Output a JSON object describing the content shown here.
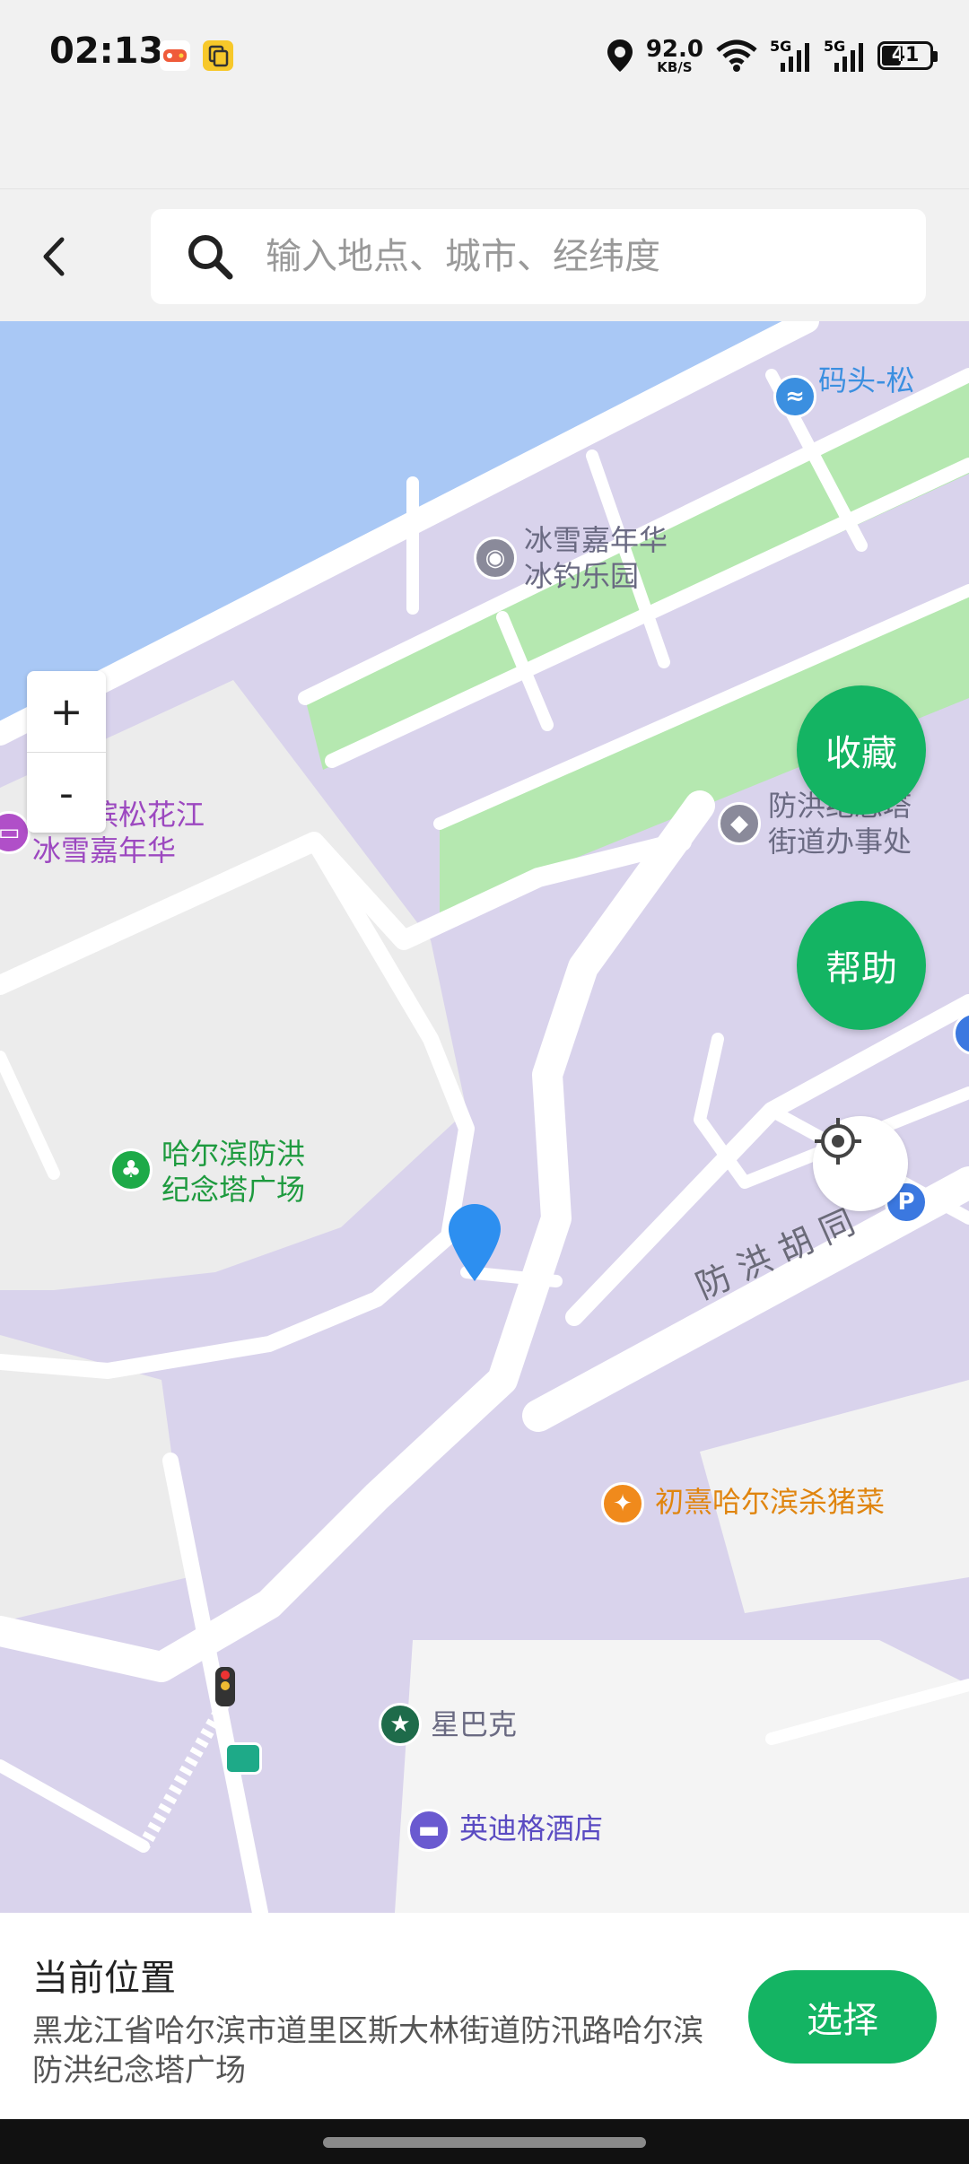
{
  "status_bar": {
    "time": "02:13",
    "net_speed": "92.0",
    "net_unit": "KB/S",
    "signal1": "5G",
    "signal2": "5G",
    "battery": "41"
  },
  "header": {
    "back_icon": "chevron-left-icon",
    "search_placeholder": "输入地点、城市、经纬度"
  },
  "map": {
    "zoom_in": "+",
    "zoom_out": "-",
    "favorite_button": "收藏",
    "help_button": "帮助",
    "street_label": "防 洪 胡 同",
    "pois": {
      "ice_park": "冰雪嘉年华\n冰钓乐园",
      "harbin_snow": "哈尔滨松花江\n冰雪嘉年华",
      "flood_street": "防洪纪念塔\n街道办事处",
      "flood_square": "哈尔滨防洪\n纪念塔广场",
      "restaurant": "初熹哈尔滨杀猪菜",
      "starbucks": "星巴克",
      "hotel": "英迪格酒店",
      "pier": "码头-松"
    },
    "colors": {
      "water": "#a9c8f5",
      "land": "#d9d3ec",
      "park": "#b5e8b0",
      "road": "#ffffff",
      "plaza": "#ececec",
      "accent": "#14b463",
      "pin": "#2d8ff0"
    }
  },
  "bottom": {
    "title": "当前位置",
    "address": "黑龙江省哈尔滨市道里区斯大林街道防汛路哈尔滨防洪纪念塔广场",
    "select_button": "选择"
  }
}
